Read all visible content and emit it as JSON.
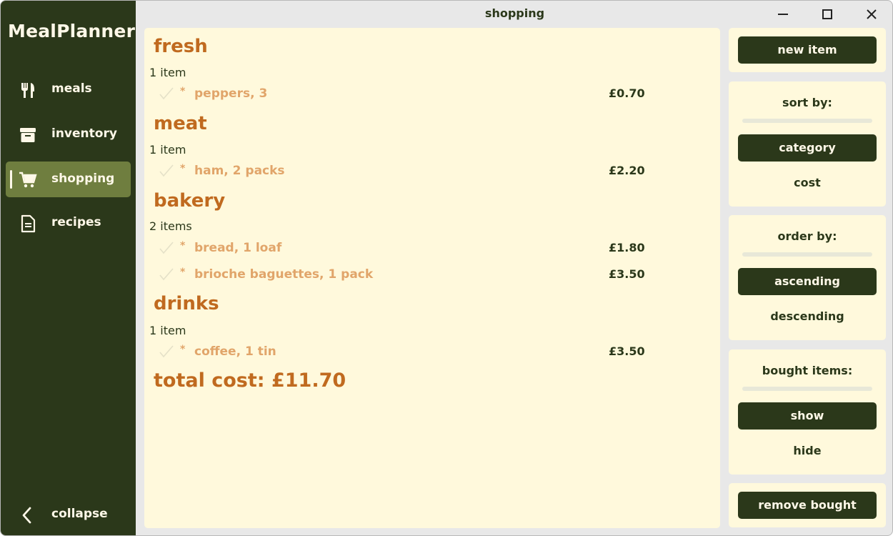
{
  "app": {
    "title": "MealPlanner"
  },
  "sidebar": {
    "items": [
      {
        "label": "meals",
        "icon": "utensils-icon"
      },
      {
        "label": "inventory",
        "icon": "archive-box-icon"
      },
      {
        "label": "shopping",
        "icon": "shopping-cart-icon",
        "active": true
      },
      {
        "label": "recipes",
        "icon": "document-icon"
      }
    ],
    "collapse_label": "collapse"
  },
  "window": {
    "title": "shopping"
  },
  "list": {
    "categories": [
      {
        "name": "fresh",
        "count": "1 item",
        "items": [
          {
            "name": "peppers, 3",
            "price": "£0.70"
          }
        ]
      },
      {
        "name": "meat",
        "count": "1 item",
        "items": [
          {
            "name": "ham, 2 packs",
            "price": "£2.20"
          }
        ]
      },
      {
        "name": "bakery",
        "count": "2 items",
        "items": [
          {
            "name": "bread, 1 loaf",
            "price": "£1.80"
          },
          {
            "name": "brioche baguettes, 1 pack",
            "price": "£3.50"
          }
        ]
      },
      {
        "name": "drinks",
        "count": "1 item",
        "items": [
          {
            "name": "coffee, 1 tin",
            "price": "£3.50"
          }
        ]
      }
    ],
    "bullet": "*",
    "total": "total cost: £11.70"
  },
  "controls": {
    "new_item": "new item",
    "sort_label": "sort by:",
    "sort_selected": "category",
    "sort_other": "cost",
    "order_label": "order by:",
    "order_selected": "ascending",
    "order_other": "descending",
    "bought_label": "bought items:",
    "bought_selected": "show",
    "bought_other": "hide",
    "remove_bought": "remove bought"
  },
  "colors": {
    "sidebar_bg": "#2b381a",
    "active_bg": "#6f7e3f",
    "panel_bg": "#fff9dc",
    "heading": "#c06a1f",
    "item_text": "#e1a56a"
  }
}
